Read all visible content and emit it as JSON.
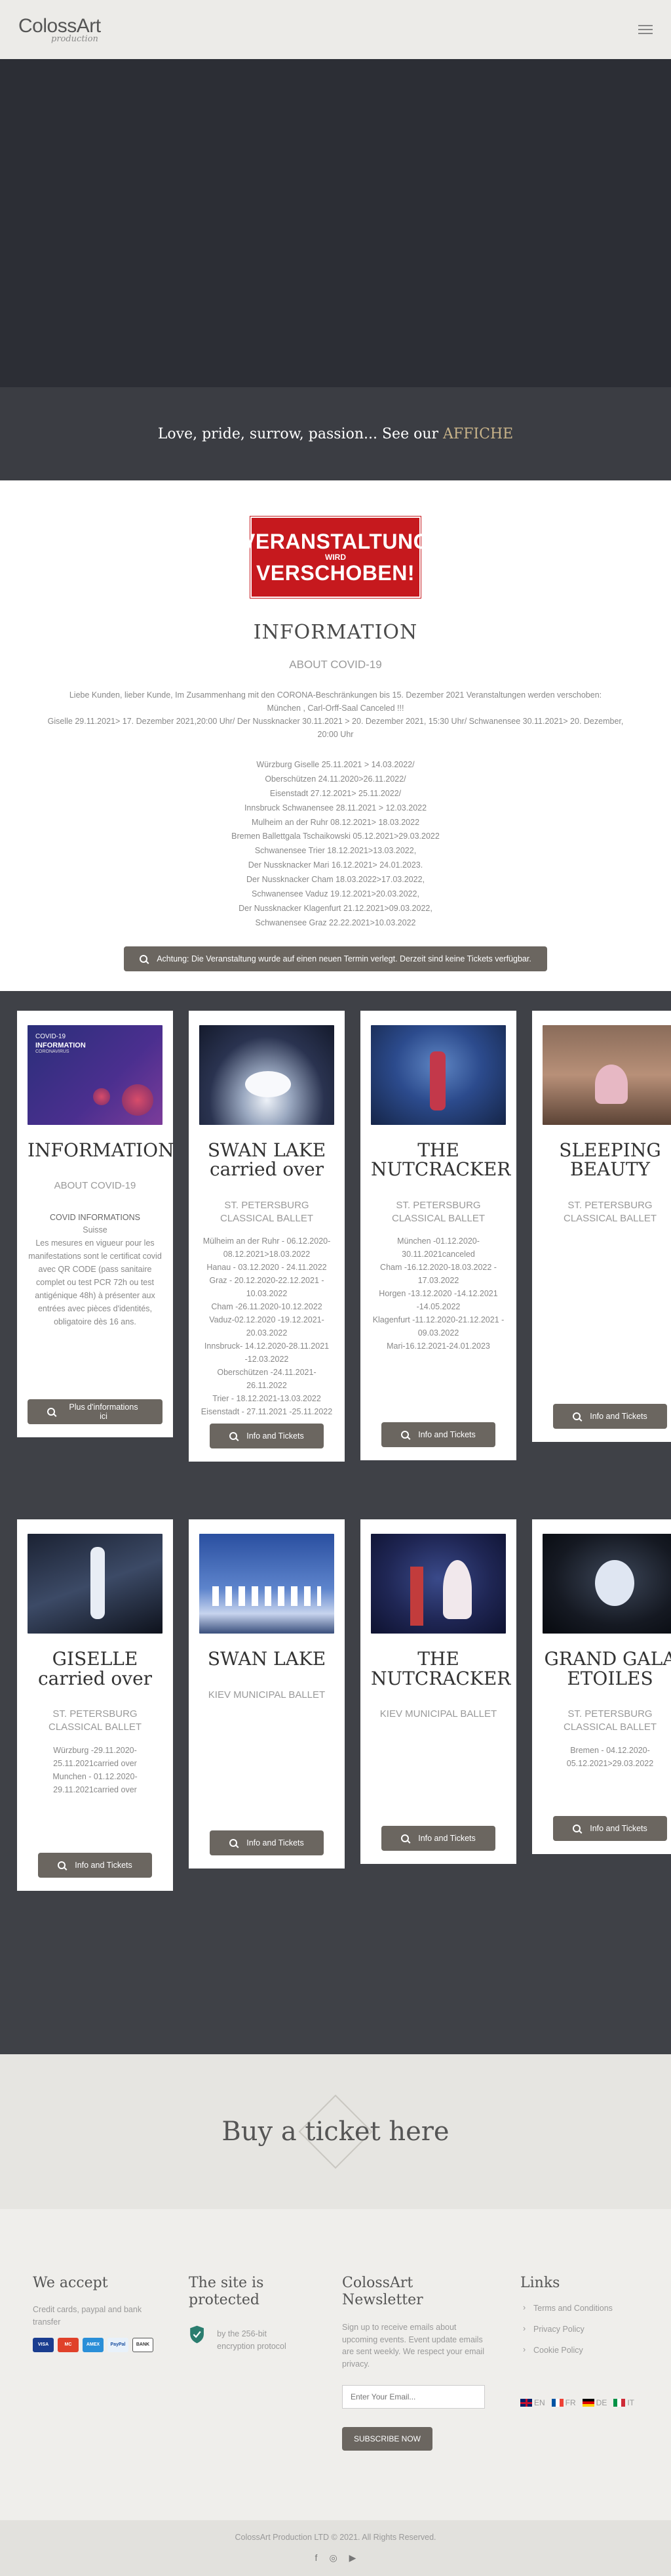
{
  "header": {
    "logo_main": "ColossArt",
    "logo_sub": "production"
  },
  "tagline": {
    "text": "Love, pride, surrow, passion... See our ",
    "link": "AFFICHE"
  },
  "info": {
    "sign_line1": "VERANSTALTUNG",
    "sign_line2": "WIRD",
    "sign_line3": "VERSCHOBEN!",
    "title": "INFORMATION",
    "subtitle": "ABOUT COVID-19",
    "paragraph_1": "Liebe Kunden, lieber Kunde, Im Zusammenhang mit den CORONA-Beschränkungen bis 15. Dezember 2021 Veranstaltungen werden verschoben:",
    "paragraph_2": "München , Carl-Orff-Saal Canceled !!!",
    "paragraph_3": "Giselle 29.11.2021> 17. Dezember 2021,20:00 Uhr/ Der Nussknacker 30.11.2021 > 20. Dezember 2021, 15:30 Uhr/ Schwanensee 30.11.2021> 20. Dezember, 20:00 Uhr",
    "dates": [
      "Würzburg Giselle 25.11.2021 > 14.03.2022/",
      "Oberschützen 24.11.2020>26.11.2022/",
      "Eisenstadt 27.12.2021> 25.11.2022/",
      "Innsbruck Schwanensee 28.11.2021 > 12.03.2022",
      "Mulheim an der Ruhr 08.12.2021> 18.03.2022",
      "Bremen Ballettgala Tschaikowski 05.12.2021>29.03.2022",
      "Schwanensee Trier 18.12.2021>13.03.2022,",
      "Der Nussknacker Mari 16.12.2021> 24.01.2023.",
      "Der Nussknacker Cham 18.03.2022>17.03.2022,",
      "Schwanensee Vaduz 19.12.2021>20.03.2022,",
      "Der Nussknacker Klagenfurt 21.12.2021>09.03.2022,",
      "Schwanensee Graz 22.22.2021>10.03.2022"
    ],
    "notice_button": "Achtung: Die Veranstaltung wurde auf einen neuen Termin verlegt. Derzeit sind keine Tickets verfügbar."
  },
  "shows_row1": [
    {
      "title": "INFORMATION",
      "company": "ABOUT COVID-19",
      "covid_title": "COVID INFORMATIONS",
      "details": "Suisse\nLes mesures en vigueur pour les manifestations sont le certificat covid avec QR CODE (pass sanitaire complet ou test PCR 72h ou test antigénique 48h) à présenter aux entrées avec pièces d'identités, obligatoire dès 16 ans.",
      "button": "Plus d'informations ici",
      "thumb_text_1": "COVID-19",
      "thumb_text_2": "INFORMATION",
      "thumb_text_3": "CORONAVIRUS"
    },
    {
      "title": "SWAN LAKE carried over",
      "company": "ST. PETERSBURG CLASSICAL BALLET",
      "details": "Mülheim an der Ruhr - 06.12.2020-08.12.2021>18.03.2022\nHanau - 03.12.2020 - 24.11.2022\nGraz - 20.12.2020-22.12.2021 - 10.03.2022\nCham -26.11.2020-10.12.2022\nVaduz-02.12.2020 -19.12.2021- 20.03.2022\nInnsbruck- 14.12.2020-28.11.2021 -12.03.2022\nOberschützen -24.11.2021-26.11.2022\nTrier - 18.12.2021-13.03.2022\nEisenstadt - 27.11.2021 -25.11.2022",
      "button": "Info and Tickets"
    },
    {
      "title": "THE NUTCRACKER",
      "company": "ST. PETERSBURG CLASSICAL BALLET",
      "details": "München -01.12.2020-30.11.2021canceled\nCham -16.12.2020-18.03.2022 - 17.03.2022\nHorgen -13.12.2020 -14.12.2021 -14.05.2022\nKlagenfurt -11.12.2020-21.12.2021 - 09.03.2022\nMari-16.12.2021-24.01.2023",
      "button": "Info and Tickets"
    },
    {
      "title": "SLEEPING BEAUTY",
      "company": "ST. PETERSBURG CLASSICAL BALLET",
      "details": "",
      "button": "Info and Tickets"
    }
  ],
  "shows_row2": [
    {
      "title": "GISELLE carried over",
      "company": "ST. PETERSBURG CLASSICAL BALLET",
      "details": "Würzburg -29.11.2020-25.11.2021carried over\nMunchen - 01.12.2020-29.11.2021carried over",
      "button": "Info and Tickets"
    },
    {
      "title": "SWAN LAKE",
      "company": "KIEV MUNICIPAL BALLET",
      "details": "",
      "button": "Info and Tickets"
    },
    {
      "title": "THE NUTCRACKER",
      "company": "KIEV MUNICIPAL BALLET",
      "details": "",
      "button": "Info and Tickets"
    },
    {
      "title": "GRAND GALA ETOILES",
      "company": "ST. PETERSBURG CLASSICAL BALLET",
      "details": "Bremen - 04.12.2020-05.12.2021>29.03.2022",
      "button": "Info and Tickets"
    }
  ],
  "buy": {
    "title": "Buy a ticket here"
  },
  "footer": {
    "accept_title": "We accept",
    "accept_text": "Credit cards, paypal and bank transfer",
    "cards": [
      "VISA",
      "MC",
      "AMEX",
      "PayPal",
      "BANK"
    ],
    "protected_title": "The site is protected",
    "protected_text": "by the 256-bit encryption protocol",
    "newsletter_title": "ColossArt Newsletter",
    "newsletter_text": "Sign up to receive emails about upcoming events. Event update emails are sent weekly. We respect your email privacy.",
    "email_placeholder": "Enter Your Email...",
    "subscribe": "SUBSCRIBE NOW",
    "links_title": "Links",
    "links": [
      "Terms and Conditions",
      "Privacy Policy",
      "Cookie Policy"
    ],
    "langs": [
      "EN",
      "FR",
      "DE",
      "IT"
    ],
    "copyright": "ColossArt Production LTD © 2021. All Rights Reserved.",
    "social": [
      "f",
      "◎",
      "▶"
    ]
  },
  "colors": {
    "accent": "#c9b48a",
    "button": "#6b6660",
    "dark": "#3f4147"
  }
}
